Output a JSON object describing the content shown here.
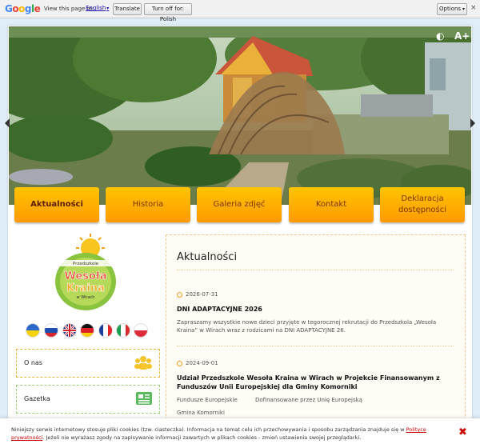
{
  "translate_bar": {
    "logo": "Google",
    "label": "View this page in:",
    "language": "English",
    "translate_button": "Translate",
    "turn_off_button": "Turn off for: Polish",
    "options_button": "Options",
    "close_symbol": "×"
  },
  "accessibility": {
    "contrast_icon": "◐",
    "font_size": "A+"
  },
  "nav": [
    {
      "label": "Aktualności",
      "active": true
    },
    {
      "label": "Historia"
    },
    {
      "label": "Galeria zdjęć"
    },
    {
      "label": "Kontakt"
    },
    {
      "label": "Deklaracja dostępności"
    }
  ],
  "logo": {
    "line1": "Przedszkole",
    "line2": "Wesoła",
    "line3": "Kraina",
    "line4": "w Wirach"
  },
  "flags": [
    "ua",
    "ru",
    "gb",
    "de",
    "fr",
    "it",
    "pl"
  ],
  "sidebar": [
    {
      "label": "O nas",
      "icon": "users-icon",
      "color": "#f5c32c"
    },
    {
      "label": "Gazetka",
      "icon": "newspaper-icon",
      "color": "#5cb85c"
    }
  ],
  "main": {
    "title": "Aktualności",
    "news": [
      {
        "date": "2026-07-31",
        "title": "DNI ADAPTACYJNE 2026",
        "desc": "Zapraszamy wszystkie nowe dzieci przyjęte  w tegorocznej rekrutacji do Przedszkola „Wesoła Kraina” w Wirach wraz z rodzicami na DNI ADAPTACYJNE 26."
      },
      {
        "date": "2024-09-01",
        "title": "Udział Przedszkole Wesoła Kraina w Wirach w Projekcie Finansowanym z Funduszów Unii Europejskiej dla Gminy Komorniki",
        "desc": "Fundusze Europejskie          Dofinansowane przez Unię Europejską",
        "desc2": "Gmina Komorniki"
      }
    ]
  },
  "cookie": {
    "text1": "Niniejszy serwis internetowy stosuje pliki cookies (tzw. ciasteczka). Informacja na temat celu ich przechowywania i sposobu zarządzania znajduje się w ",
    "link": "Polityce prywatności",
    "text2": ". Jeżeli nie wyrażasz zgody na zapisywanie informacji zawartych w plikach cookies - zmień ustawienia swojej przeglądarki.",
    "close": "✖"
  }
}
